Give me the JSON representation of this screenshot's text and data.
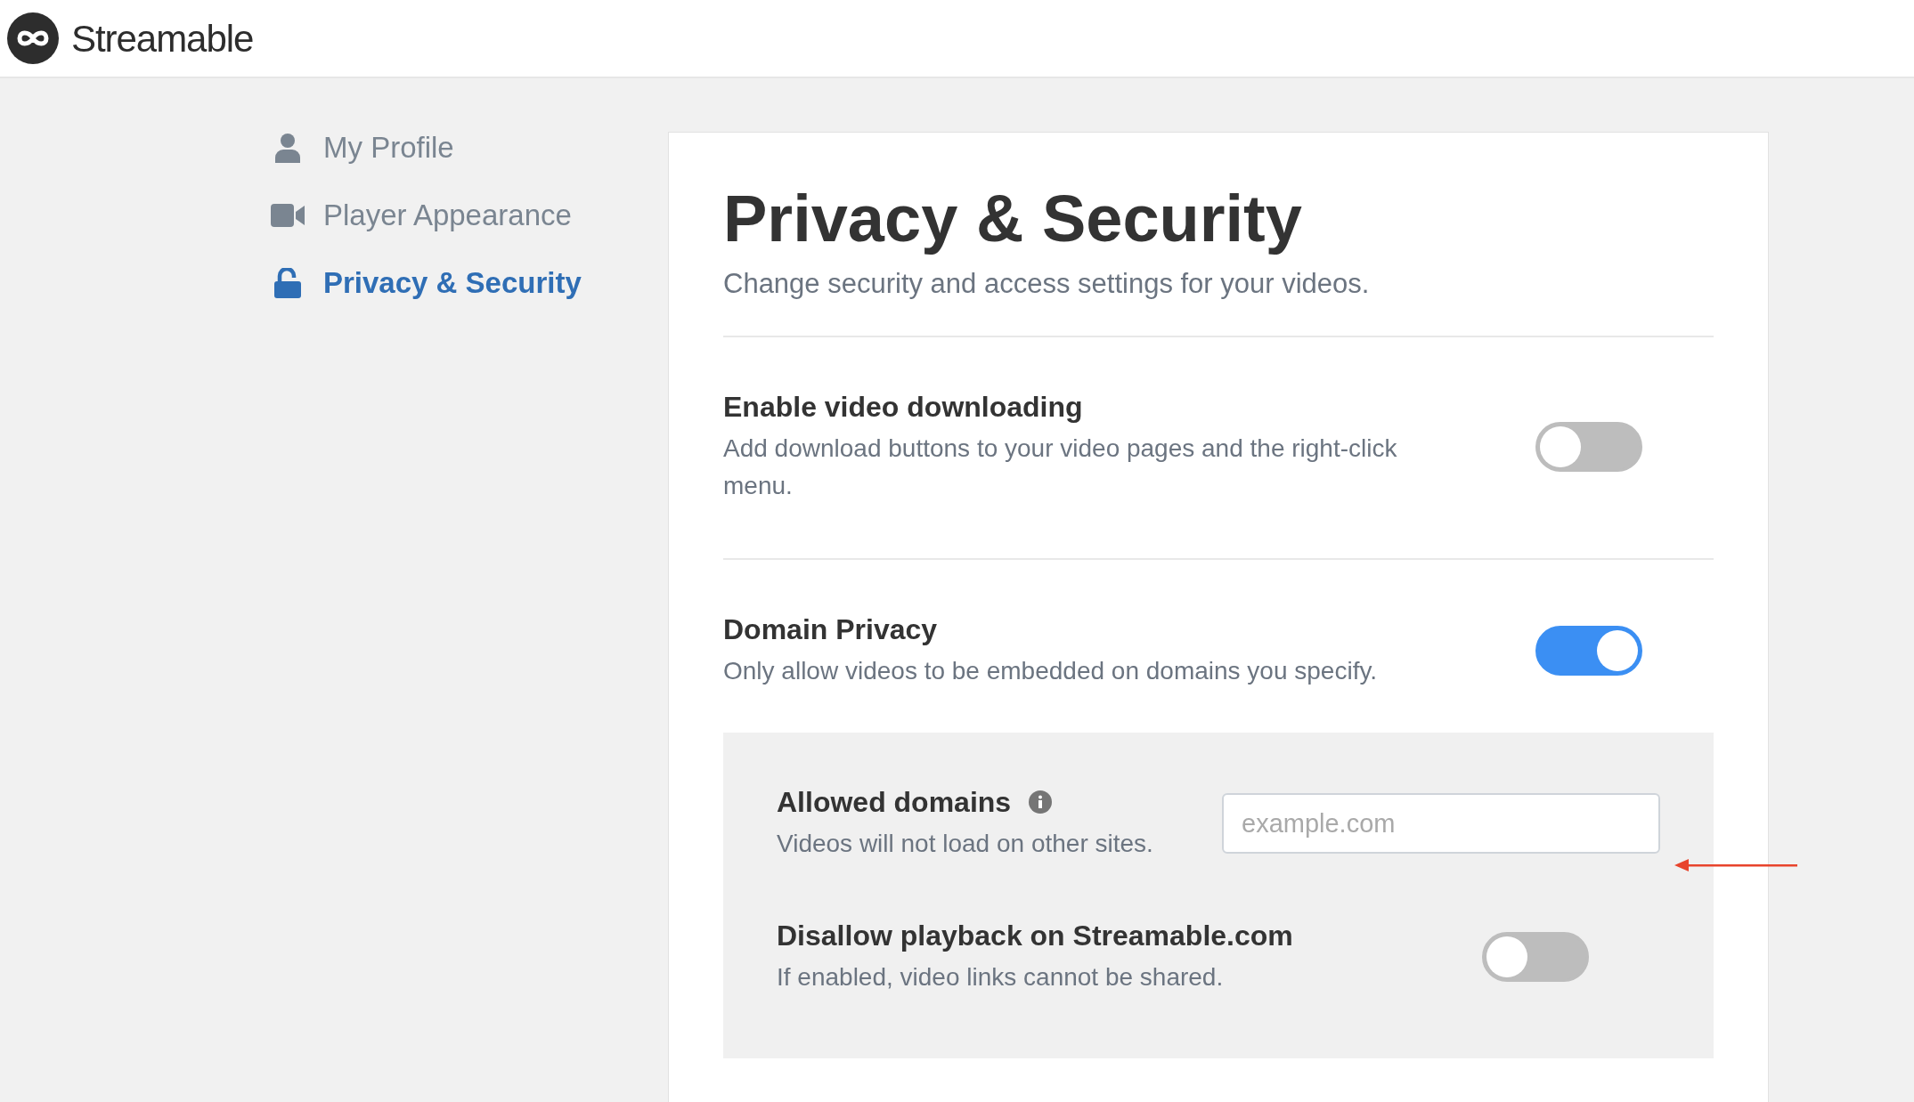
{
  "header": {
    "brand": "Streamable"
  },
  "sidebar": {
    "items": [
      {
        "label": "My Profile",
        "kind": "user",
        "selected": false
      },
      {
        "label": "Player Appearance",
        "kind": "video",
        "selected": false
      },
      {
        "label": "Privacy & Security",
        "kind": "lock",
        "selected": true
      }
    ]
  },
  "page": {
    "title": "Privacy & Security",
    "subtitle": "Change security and access settings for your videos."
  },
  "settings": [
    {
      "title": "Enable video downloading",
      "description": "Add download buttons to your video pages and the right-click menu.",
      "on": false
    },
    {
      "title": "Domain Privacy",
      "description": "Only allow videos to be embedded on domains you specify.",
      "on": true
    }
  ],
  "domain_panel": {
    "label": "Allowed domains",
    "description": "Videos will not load on other sites.",
    "placeholder": "example.com",
    "setting": {
      "title": "Disallow playback on Streamable.com",
      "description": "If enabled, video links cannot be shared.",
      "on": false
    }
  }
}
